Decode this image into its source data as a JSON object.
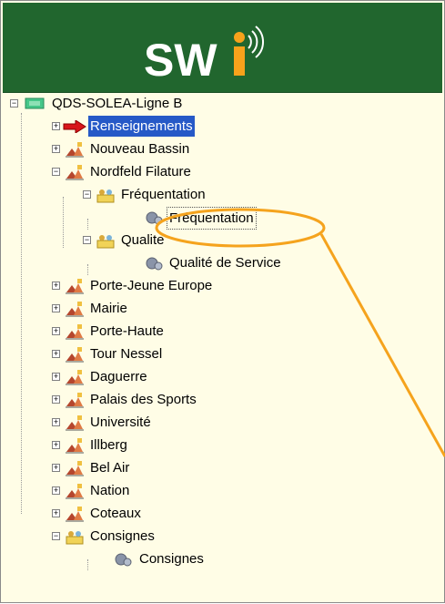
{
  "brand": {
    "logo_text": "SWi",
    "accent": "#f7a21b",
    "banner_color": "#21662e"
  },
  "tree": {
    "root": {
      "label": "QDS-SOLEA-Ligne B",
      "icon": "network-icon"
    },
    "items": [
      {
        "label": "Renseignements",
        "icon": "red-arrow-icon",
        "expander": "+",
        "selected": true
      },
      {
        "label": "Nouveau Bassin",
        "icon": "station-icon",
        "expander": "+"
      },
      {
        "label": "Nordfeld Filature",
        "icon": "station-icon",
        "expander": "-"
      },
      {
        "label": "Fréquentation",
        "icon": "group-icon",
        "expander": "-"
      },
      {
        "label": "Fréquentation",
        "icon": "gear-icon",
        "focused": true
      },
      {
        "label": "Qualite",
        "icon": "group-icon",
        "expander": "-"
      },
      {
        "label": "Qualité de Service",
        "icon": "gear-icon"
      },
      {
        "label": "Porte-Jeune Europe",
        "icon": "station-icon",
        "expander": "+"
      },
      {
        "label": "Mairie",
        "icon": "station-icon",
        "expander": "+"
      },
      {
        "label": "Porte-Haute",
        "icon": "station-icon",
        "expander": "+"
      },
      {
        "label": "Tour Nessel",
        "icon": "station-icon",
        "expander": "+"
      },
      {
        "label": "Daguerre",
        "icon": "station-icon",
        "expander": "+"
      },
      {
        "label": "Palais des Sports",
        "icon": "station-icon",
        "expander": "+"
      },
      {
        "label": "Université",
        "icon": "station-icon",
        "expander": "+"
      },
      {
        "label": "Illberg",
        "icon": "station-icon",
        "expander": "+"
      },
      {
        "label": "Bel Air",
        "icon": "station-icon",
        "expander": "+"
      },
      {
        "label": "Nation",
        "icon": "station-icon",
        "expander": "+"
      },
      {
        "label": "Coteaux",
        "icon": "station-icon",
        "expander": "+"
      },
      {
        "label": "Consignes",
        "icon": "group-icon",
        "expander": "-"
      },
      {
        "label": "Consignes",
        "icon": "gear-icon"
      }
    ]
  },
  "annotation": {
    "color": "#f5a31d",
    "shape": "callout-ellipse-with-pointer"
  }
}
